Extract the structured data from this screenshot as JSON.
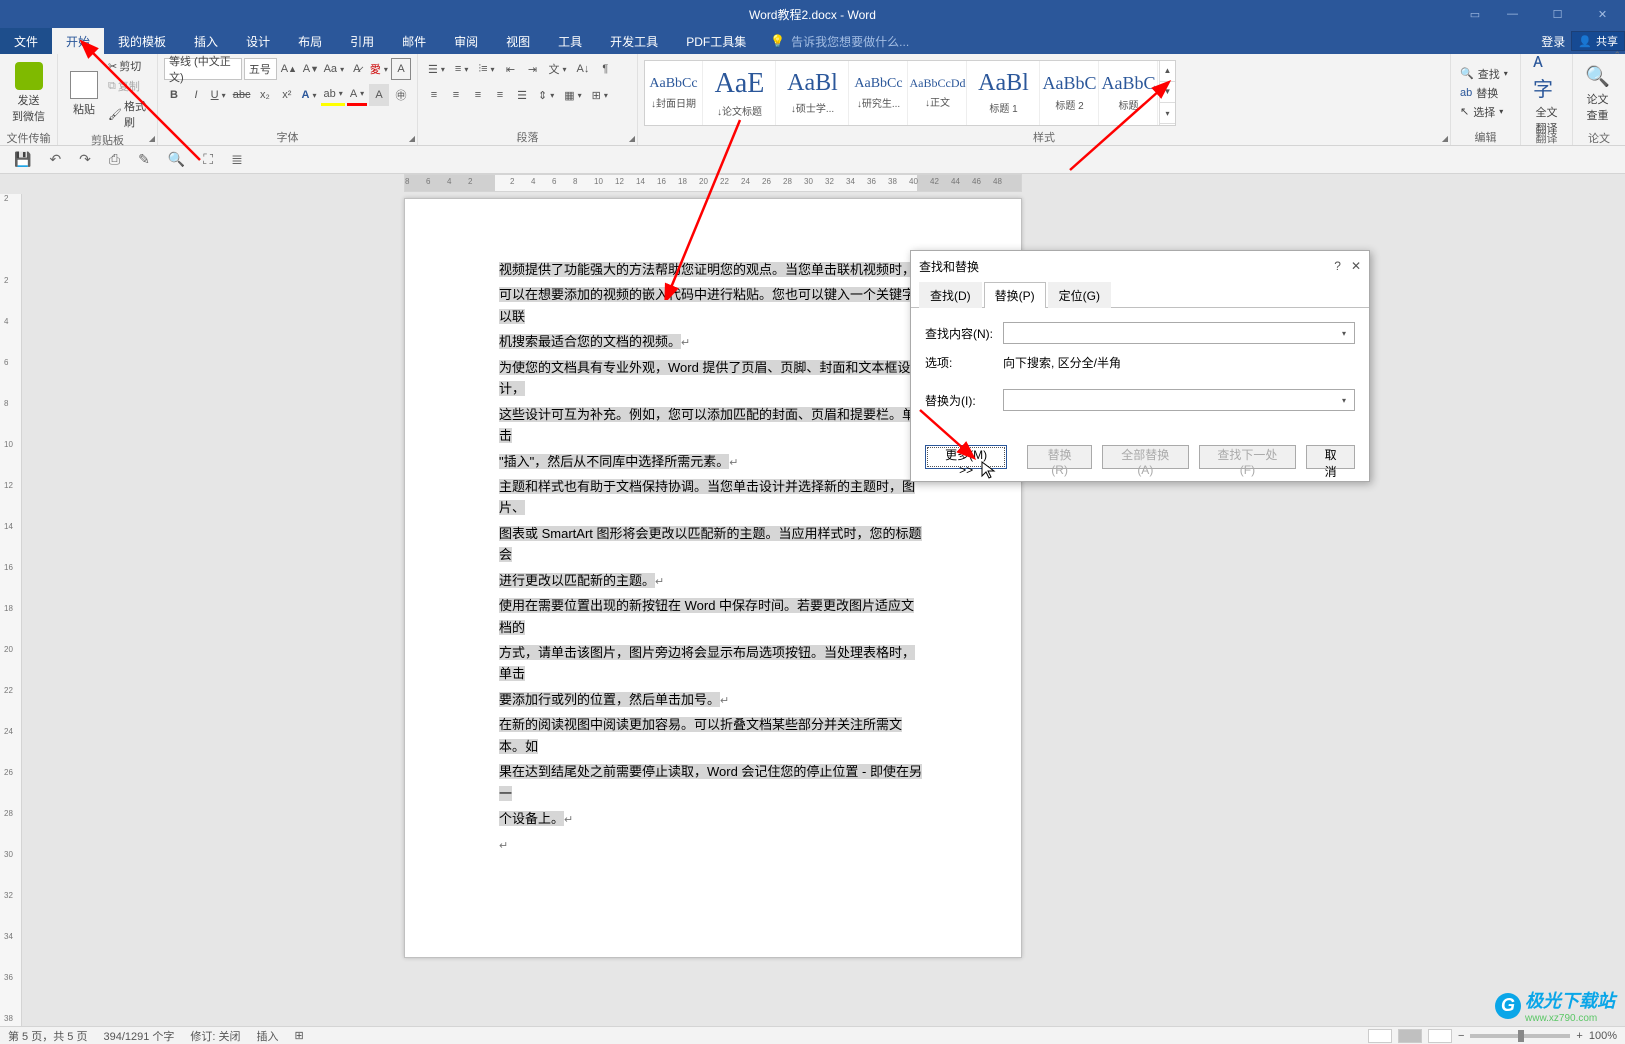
{
  "titlebar": {
    "title": "Word教程2.docx - Word",
    "login": "登录",
    "share": "共享"
  },
  "menu": {
    "file": "文件",
    "home": "开始",
    "templates": "我的模板",
    "insert": "插入",
    "design": "设计",
    "layout": "布局",
    "references": "引用",
    "mailings": "邮件",
    "review": "审阅",
    "view": "视图",
    "tools": "工具",
    "developer": "开发工具",
    "pdf": "PDF工具集",
    "tellme": "告诉我您想要做什么..."
  },
  "ribbon": {
    "wechat": "发送\n到微信",
    "filetransfer": "文件传输",
    "paste": "粘贴",
    "cut": "剪切",
    "copy": "复制",
    "format_painter": "格式刷",
    "clipboard": "剪贴板",
    "font_name": "等线 (中文正文)",
    "font_size": "五号",
    "font_group": "字体",
    "para_group": "段落",
    "styles_group": "样式",
    "styles": [
      {
        "preview": "AaBbCc",
        "name": "↓封面日期",
        "cls": ""
      },
      {
        "preview": "AaE",
        "name": "↓论文标题",
        "cls": "wide",
        "psize": "28px"
      },
      {
        "preview": "AaBl",
        "name": "↓硕士学...",
        "cls": "wide",
        "psize": "24px"
      },
      {
        "preview": "AaBbCc",
        "name": "↓研究生...",
        "cls": ""
      },
      {
        "preview": "AaBbCcDd",
        "name": "↓正文",
        "cls": "",
        "psize": "12px"
      },
      {
        "preview": "AaBl",
        "name": "标题 1",
        "cls": "wide",
        "psize": "24px"
      },
      {
        "preview": "AaBbC",
        "name": "标题 2",
        "cls": "",
        "psize": "18px"
      },
      {
        "preview": "AaBbC",
        "name": "标题",
        "cls": "",
        "psize": "18px"
      }
    ],
    "find": "查找",
    "replace": "替换",
    "select": "选择",
    "editing": "编辑",
    "translate_full": "全文\n翻译",
    "translate_group": "翻译",
    "dup_check": "论文\n查重",
    "dup_group": "论文"
  },
  "dialog": {
    "title": "查找和替换",
    "tab_find": "查找(D)",
    "tab_replace": "替换(P)",
    "tab_goto": "定位(G)",
    "find_label": "查找内容(N):",
    "options_label": "选项:",
    "options_val": "向下搜索, 区分全/半角",
    "replace_label": "替换为(I):",
    "more": "更多(M) >>",
    "btn_replace": "替换(R)",
    "btn_replace_all": "全部替换(A)",
    "btn_find_next": "查找下一处(F)",
    "btn_cancel": "取消"
  },
  "doc": {
    "p1a": "视频提供了功能强大的方法帮助您证明您的观点。当您单击联机视频时，",
    "p1b": "可以在想要添加的视频的嵌入代码中进行粘贴。您也可以键入一个关键字以联",
    "p1c": "机搜索最适合您的文档的视频。",
    "p2a": "为使您的文档具有专业外观，Word 提供了页眉、页脚、封面和文本框设计，",
    "p2b": "这些设计可互为补充。例如，您可以添加匹配的封面、页眉和提要栏。单击",
    "p2c": "\"插入\"，然后从不同库中选择所需元素。",
    "p3a": "主题和样式也有助于文档保持协调。当您单击设计并选择新的主题时，图片、",
    "p3b": "图表或 SmartArt 图形将会更改以匹配新的主题。当应用样式时，您的标题会",
    "p3c": "进行更改以匹配新的主题。",
    "p4a": "使用在需要位置出现的新按钮在 Word 中保存时间。若要更改图片适应文档的",
    "p4b": "方式，请单击该图片，图片旁边将会显示布局选项按钮。当处理表格时，单击",
    "p4c": "要添加行或列的位置，然后单击加号。",
    "p5a": "在新的阅读视图中阅读更加容易。可以折叠文档某些部分并关注所需文本。如",
    "p5b": "果在达到结尾处之前需要停止读取，Word 会记住您的停止位置 - 即使在另一",
    "p5c": "个设备上。"
  },
  "status": {
    "page": "第 5 页，共 5 页",
    "words": "394/1291 个字",
    "track": "修订: 关闭",
    "insert": "插入",
    "zoom": "100%"
  },
  "watermark": {
    "main": "极光下载站",
    "sub": "www.xz790.com"
  },
  "ruler_h": [
    "8",
    "6",
    "4",
    "2",
    "",
    "2",
    "4",
    "6",
    "8",
    "10",
    "12",
    "14",
    "16",
    "18",
    "20",
    "22",
    "24",
    "26",
    "28",
    "30",
    "32",
    "34",
    "36",
    "38",
    "40",
    "42",
    "44",
    "46",
    "48"
  ],
  "ruler_v": [
    "2",
    "",
    "2",
    "4",
    "6",
    "8",
    "10",
    "12",
    "14",
    "16",
    "18",
    "20",
    "22",
    "24",
    "26",
    "28",
    "30",
    "32",
    "34",
    "36",
    "38"
  ]
}
